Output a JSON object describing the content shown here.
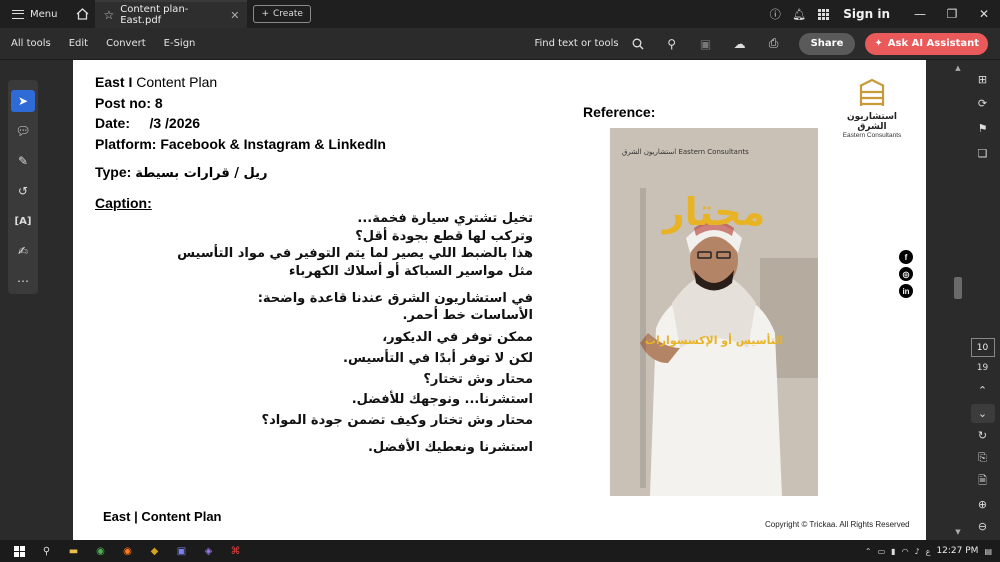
{
  "titlebar": {
    "menu_label": "Menu",
    "tab_title": "Content plan- East.pdf",
    "create_label": "Create",
    "signin_label": "Sign in"
  },
  "toolbar": {
    "tools": [
      "All tools",
      "Edit",
      "Convert",
      "E-Sign"
    ],
    "find_label": "Find text or tools",
    "share_label": "Share",
    "ask_ai_label": "Ask AI Assistant"
  },
  "document": {
    "header_brand": "East I",
    "header_rest": "Content Plan",
    "post_label": "Post no:",
    "post_value": "8",
    "date_label": "Date:",
    "date_value": "/3 /2026",
    "platform_label": "Platform:",
    "platform_value": "Facebook & Instagram & LinkedIn",
    "type_label": "Type:",
    "type_value": "ريل / قرارات بسيطة",
    "caption_heading": "Caption:",
    "caption_lines": [
      "تخيل تشتري سيارة فخمة...",
      "وتركب لها قطع بجودة أقل؟",
      "هذا بالضبط اللي يصير لما يتم التوفير في مواد التأسيس",
      "مثل مواسير السباكة أو أسلاك الكهرباء",
      "",
      "في استشاريون الشرق عندنا قاعدة واضحة:",
      "الأساسات خط أحمر.",
      "ممكن توفر في الديكور،",
      "لكن لا توفر أبدًا في التأسيس.",
      "محتار وش تختار؟",
      "استشرنا... ونوجهك للأفضل.",
      "محتار وش تختار وكيف تضمن جودة المواد؟",
      "استشرنا ونعطيك الأفضل."
    ],
    "reference_label": "Reference:",
    "reference_title": "محتار",
    "reference_subtitle": "التأسيس أو الإكسسوارات",
    "reference_brand": "استشاريون الشرق Eastern Consultants",
    "logo_arabic": "استشاريون الشرق",
    "logo_english": "Eastern Consultants",
    "footer_left": "East | Content Plan",
    "footer_right": "Copyright © Trickaa. All Rights Reserved"
  },
  "socials": [
    {
      "icon": "facebook-icon",
      "glyph": "f"
    },
    {
      "icon": "instagram-icon",
      "glyph": "◎"
    },
    {
      "icon": "linkedin-icon",
      "glyph": "in"
    }
  ],
  "pager": {
    "current_page": "10",
    "total_pages": "19"
  },
  "taskbar": {
    "time": "12:27 PM",
    "lang": "ع"
  },
  "colors": {
    "accent_red": "#ea5a5a",
    "active_tool": "#2f6bd6",
    "gold": "#e8b325"
  }
}
